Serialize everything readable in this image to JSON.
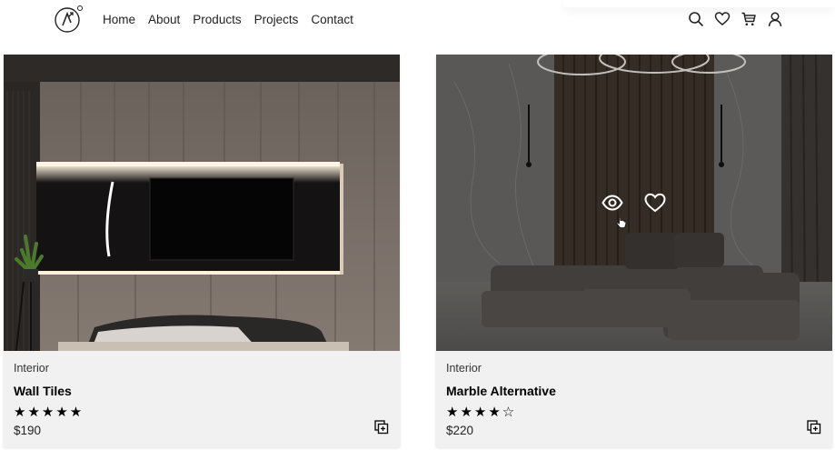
{
  "nav": {
    "items": [
      "Home",
      "About",
      "Products",
      "Projects",
      "Contact"
    ]
  },
  "header_icons": [
    "search-icon",
    "heart-icon",
    "cart-icon",
    "user-icon"
  ],
  "products": [
    {
      "category": "Interior",
      "title": "Wall Tiles",
      "rating": 5,
      "stars": "★★★★★",
      "price": "$190"
    },
    {
      "category": "Interior",
      "title": "Marble Alternative",
      "rating": 4,
      "stars": "★★★★☆",
      "price": "$220"
    }
  ],
  "colors": {
    "card_bg": "#f1f1f1",
    "text": "#111111",
    "overlay_icon": "#ffffff"
  }
}
